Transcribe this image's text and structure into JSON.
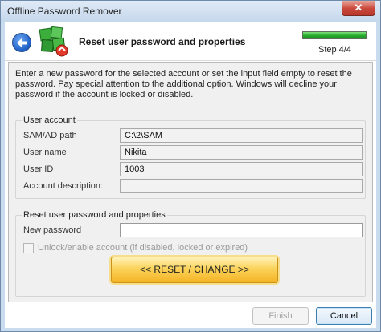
{
  "window": {
    "title": "Offline Password Remover",
    "close_symbol": "✕"
  },
  "header": {
    "title": "Reset user password and properties",
    "step": "Step 4/4",
    "progress": 1.0
  },
  "intro": "Enter a new password for the selected account or set the input field empty to reset the password. Pay special attention to the additional option. Windows will decline your password if the account is locked or disabled.",
  "user_account": {
    "title": "User account",
    "sam_label": "SAM/AD path",
    "sam_value": "C:\\2\\SAM",
    "username_label": "User name",
    "username_value": "Nikita",
    "userid_label": "User ID",
    "userid_value": "1003",
    "description_label": "Account description:",
    "description_value": ""
  },
  "reset_section": {
    "title": "Reset user password and properties",
    "new_password_label": "New password",
    "new_password_value": "",
    "unlock_label": "Unlock/enable account (if disabled, locked or expired)",
    "reset_button": "<< RESET / CHANGE >>"
  },
  "footer": {
    "finish_label": "Finish",
    "cancel_label": "Cancel"
  },
  "icons": {
    "back": "back-arrow-icon",
    "logo": "app-logo-icon"
  },
  "colors": {
    "reset_button": "#fbd35a",
    "progress": "#22a829",
    "back_button": "#1f5fc6"
  }
}
